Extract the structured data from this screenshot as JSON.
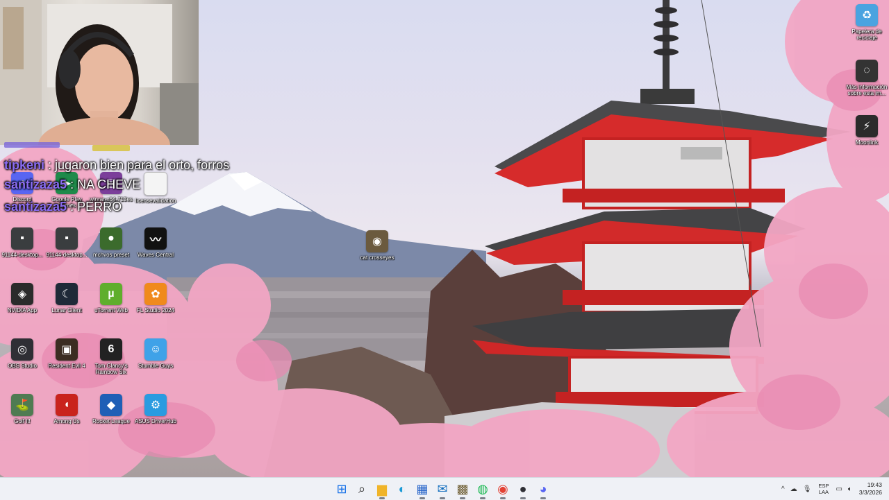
{
  "chat": [
    {
      "user": "tipkeni",
      "message": ": jugaron bien para el orto, forros"
    },
    {
      "user": "santizaza5",
      "message": ": NA CHEVE"
    },
    {
      "user": "santizaza5",
      "message": ": PERRO"
    }
  ],
  "desktop_icons": [
    {
      "label": "Discord",
      "icon": "discord-icon",
      "color": "#5865f2",
      "glyph": "◕"
    },
    {
      "label": "Google Play Games",
      "icon": "google-play-games-icon",
      "color": "#1e8a4a",
      "glyph": "▶"
    },
    {
      "label": "winrar-x64-713es",
      "icon": "winrar-icon",
      "color": "#7b3e9a",
      "glyph": "▤"
    },
    {
      "label": "licensevalidation",
      "icon": "file-icon",
      "color": "#f4f4f4",
      "glyph": ""
    },
    {
      "label": "91144-desktop...",
      "icon": "desktop-file-icon",
      "color": "#3a3d3f",
      "glyph": "▪"
    },
    {
      "label": "91144-desktop...",
      "icon": "desktop-file-icon",
      "color": "#3a3d3f",
      "glyph": "▪"
    },
    {
      "label": "mchvos preset",
      "icon": "preset-icon",
      "color": "#3b6b2c",
      "glyph": "●"
    },
    {
      "label": "Waves Central",
      "icon": "waves-central-icon",
      "color": "#111111",
      "glyph": "〰"
    },
    {
      "label": "cat crosseyes",
      "icon": "image-file-icon",
      "color": "#6b5a3e",
      "glyph": "◉"
    },
    {
      "label": "NVIDIA App",
      "icon": "nvidia-icon",
      "color": "#2b2b2b",
      "glyph": "◈"
    },
    {
      "label": "Lunar Client",
      "icon": "lunar-client-icon",
      "color": "#1f2a38",
      "glyph": "☾"
    },
    {
      "label": "uTorrent Web",
      "icon": "utorrent-icon",
      "color": "#5fae2c",
      "glyph": "µ"
    },
    {
      "label": "FL Studio 2024",
      "icon": "fl-studio-icon",
      "color": "#f08a1c",
      "glyph": "✿"
    },
    {
      "label": "OBS Studio",
      "icon": "obs-icon",
      "color": "#2f2f35",
      "glyph": "◎"
    },
    {
      "label": "Resident Evil 4",
      "icon": "resident-evil-icon",
      "color": "#3c2d22",
      "glyph": "▣"
    },
    {
      "label": "Tom Clancy's Rainbow Six",
      "icon": "rainbow-six-icon",
      "color": "#222222",
      "glyph": "6"
    },
    {
      "label": "Stumble Guys",
      "icon": "stumble-guys-icon",
      "color": "#3fa2e8",
      "glyph": "☺"
    },
    {
      "label": "Golf It!",
      "icon": "golf-it-icon",
      "color": "#4f7b52",
      "glyph": "⛳"
    },
    {
      "label": "Among Us",
      "icon": "among-us-icon",
      "color": "#c9231d",
      "glyph": "◖"
    },
    {
      "label": "Rocket League",
      "icon": "rocket-league-icon",
      "color": "#1e5fb6",
      "glyph": "◆"
    },
    {
      "label": "ASUS DriverHub",
      "icon": "asus-driverhub-icon",
      "color": "#2a9be0",
      "glyph": "⚙"
    },
    {
      "label": "Papelera de reciclaje",
      "icon": "recycle-bin-icon",
      "color": "#4aa3e0",
      "glyph": "♻"
    },
    {
      "label": "Más información sobre esta im...",
      "icon": "info-camera-icon",
      "color": "#333333",
      "glyph": "◌"
    },
    {
      "label": "Moonlink",
      "icon": "moonlink-icon",
      "color": "#2b2b2b",
      "glyph": "⚡"
    }
  ],
  "taskbar": {
    "apps": [
      {
        "name": "start-button",
        "glyph": "⊞",
        "color": "#1a73e8"
      },
      {
        "name": "search-button",
        "glyph": "⌕",
        "color": "#333333"
      },
      {
        "name": "file-explorer-button",
        "glyph": "▆",
        "color": "#f0b429"
      },
      {
        "name": "edge-button",
        "glyph": "◐",
        "color": "#1a9ad6"
      },
      {
        "name": "store-button",
        "glyph": "▦",
        "color": "#2563c9"
      },
      {
        "name": "outlook-button",
        "glyph": "✉",
        "color": "#0f6cbd"
      },
      {
        "name": "minecraft-button",
        "glyph": "▩",
        "color": "#6b5a2e"
      },
      {
        "name": "spotify-button",
        "glyph": "◍",
        "color": "#1db954"
      },
      {
        "name": "chrome-button",
        "glyph": "◉",
        "color": "#e34133"
      },
      {
        "name": "obs-button",
        "glyph": "●",
        "color": "#2f2f35"
      },
      {
        "name": "discord-button",
        "glyph": "◕",
        "color": "#5865f2"
      }
    ],
    "tray": {
      "chevron": "^",
      "language": "ESP",
      "layout": "LAA",
      "time": "19:43",
      "date": "3/3/2026"
    }
  }
}
